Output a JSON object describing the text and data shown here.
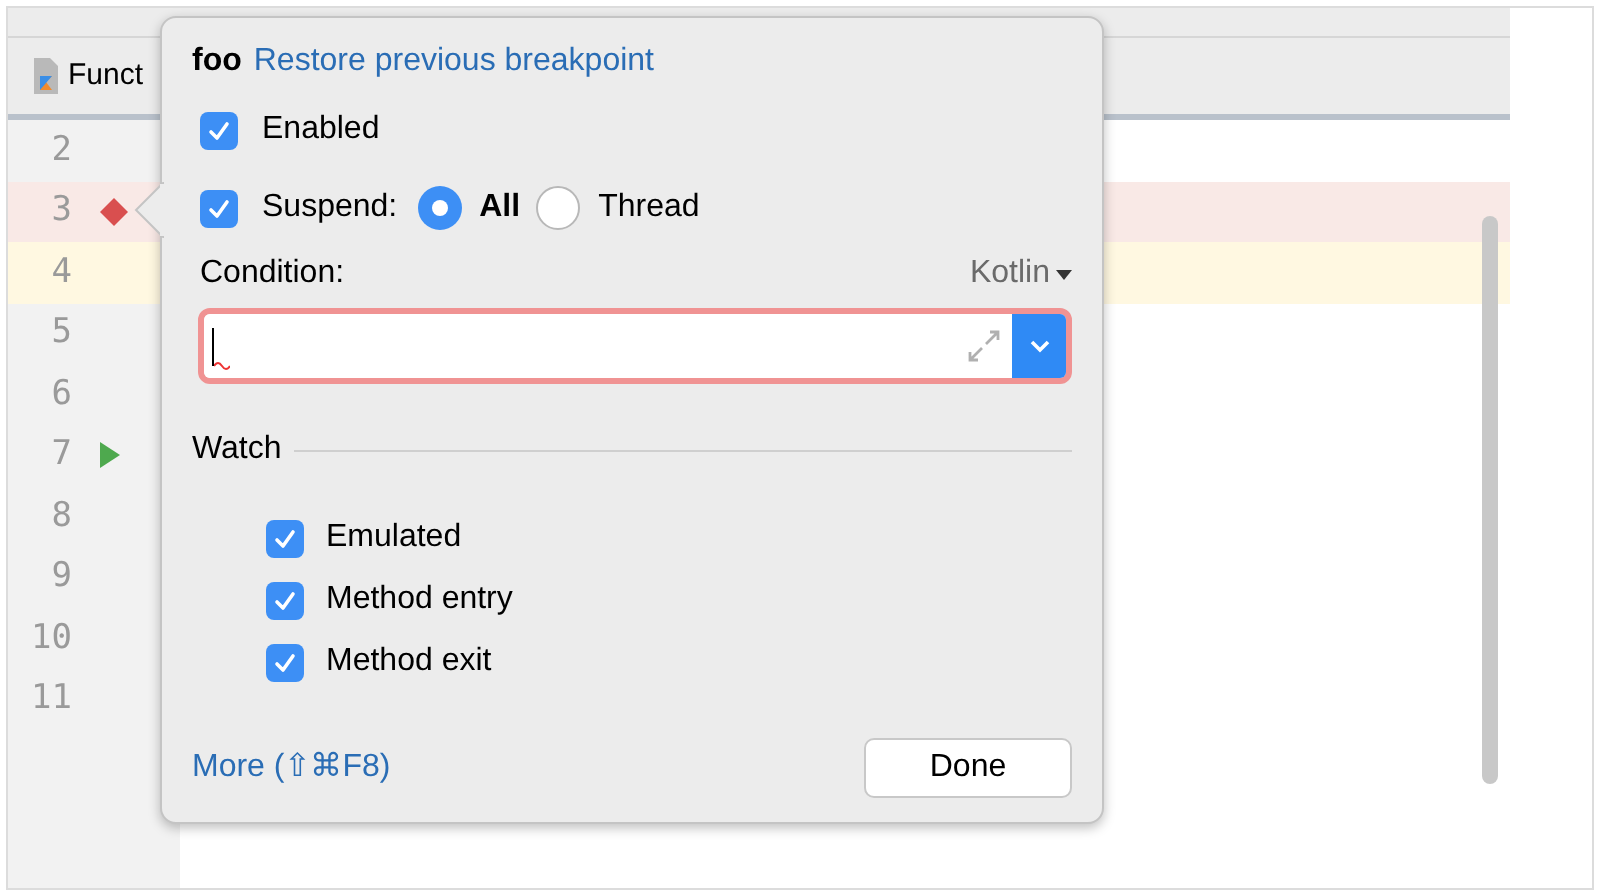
{
  "editor": {
    "tab": "Funct",
    "lines": [
      {
        "number": "2",
        "kind": "plain",
        "current": false
      },
      {
        "number": "3",
        "kind": "breakpoint",
        "current": false
      },
      {
        "number": "4",
        "kind": "plain",
        "current": true
      },
      {
        "number": "5",
        "kind": "plain",
        "current": false
      },
      {
        "number": "6",
        "kind": "plain",
        "current": false
      },
      {
        "number": "7",
        "kind": "run",
        "current": false
      },
      {
        "number": "8",
        "kind": "plain",
        "current": false
      },
      {
        "number": "9",
        "kind": "plain",
        "current": false
      },
      {
        "number": "10",
        "kind": "plain",
        "current": false
      },
      {
        "number": "11",
        "kind": "plain",
        "current": false
      }
    ]
  },
  "popup": {
    "title": "foo",
    "restore_link": "Restore previous breakpoint",
    "enabled": {
      "label": "Enabled",
      "checked": true
    },
    "suspend": {
      "label": "Suspend:",
      "checked": true,
      "options": [
        {
          "label": "All",
          "selected": true
        },
        {
          "label": "Thread",
          "selected": false
        }
      ]
    },
    "condition": {
      "label": "Condition:",
      "language": "Kotlin",
      "error": true
    },
    "watch": {
      "title": "Watch",
      "items": [
        {
          "label": "Emulated",
          "checked": true
        },
        {
          "label": "Method entry",
          "checked": true
        },
        {
          "label": "Method exit",
          "checked": true
        }
      ]
    },
    "more_link": "More (⇧⌘F8)",
    "done_button": "Done"
  }
}
